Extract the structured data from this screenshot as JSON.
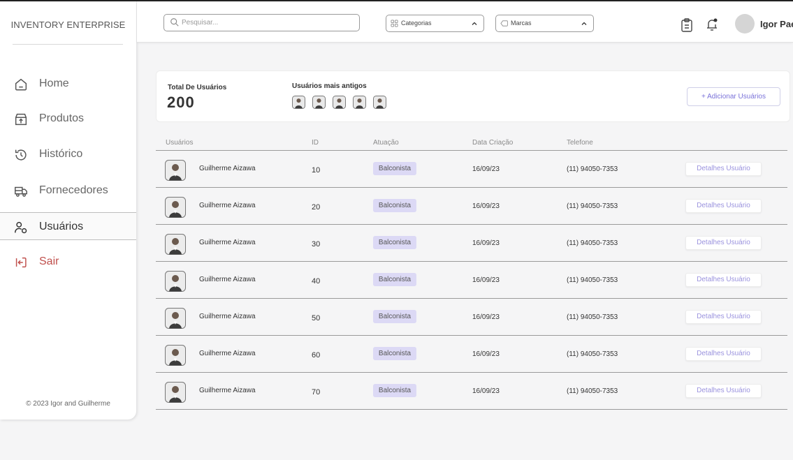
{
  "app": {
    "brand": "INVENTORY ENTERPRISE",
    "copyright": "© 2023 Igor and Guilherme"
  },
  "sidebar": {
    "items": [
      {
        "label": "Home",
        "icon": "home-icon"
      },
      {
        "label": "Produtos",
        "icon": "box-icon"
      },
      {
        "label": "Histórico",
        "icon": "history-icon"
      },
      {
        "label": "Fornecedores",
        "icon": "truck-icon"
      },
      {
        "label": "Usuários",
        "icon": "users-icon",
        "active": true
      },
      {
        "label": "Sair",
        "icon": "logout-icon"
      }
    ]
  },
  "header": {
    "search": {
      "placeholder": "Pesquisar...",
      "value": ""
    },
    "categories_label": "Categorias",
    "brands_label": "Marcas",
    "user_name": "Igor Pae"
  },
  "summary": {
    "total_label": "Total De Usuários",
    "total_value": "200",
    "oldest_label": "Usuários mais antigos",
    "add_button": "+ Adicionar Usuários"
  },
  "table": {
    "headers": [
      "Usuários",
      "ID",
      "Atuação",
      "Data Criação",
      "Telefone"
    ],
    "rows": [
      {
        "name": "Guilherme Aizawa",
        "id": "10",
        "role": "Balconista",
        "date": "16/09/23",
        "phone": "(11) 94050-7353",
        "action": "Detalhes Usuário"
      },
      {
        "name": "Guilherme Aizawa",
        "id": "20",
        "role": "Balconista",
        "date": "16/09/23",
        "phone": "(11) 94050-7353",
        "action": "Detalhes Usuário"
      },
      {
        "name": "Guilherme Aizawa",
        "id": "30",
        "role": "Balconista",
        "date": "16/09/23",
        "phone": "(11) 94050-7353",
        "action": "Detalhes Usuário"
      },
      {
        "name": "Guilherme Aizawa",
        "id": "40",
        "role": "Balconista",
        "date": "16/09/23",
        "phone": "(11) 94050-7353",
        "action": "Detalhes Usuário"
      },
      {
        "name": "Guilherme Aizawa",
        "id": "50",
        "role": "Balconista",
        "date": "16/09/23",
        "phone": "(11) 94050-7353",
        "action": "Detalhes Usuário"
      },
      {
        "name": "Guilherme Aizawa",
        "id": "60",
        "role": "Balconista",
        "date": "16/09/23",
        "phone": "(11) 94050-7353",
        "action": "Detalhes Usuário"
      },
      {
        "name": "Guilherme Aizawa",
        "id": "70",
        "role": "Balconista",
        "date": "16/09/23",
        "phone": "(11) 94050-7353",
        "action": "Detalhes Usuário"
      }
    ]
  },
  "colors": {
    "accent": "#7a72d9",
    "badge_bg": "#dcd9f5",
    "logout": "#c0504d"
  }
}
